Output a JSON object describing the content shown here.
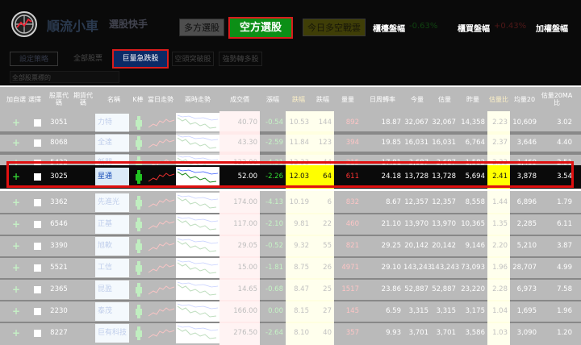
{
  "header": {
    "brand_name": "順流小車",
    "brand_sub": "選股快手",
    "tab_long": "多方選股",
    "tab_short": "空方選股",
    "tab_today": "今日多空戰雲",
    "otc_label": "櫃檯盤幅",
    "otc_value": "-0.63%",
    "tse_label": "櫃買盤幅",
    "tse_value": "+0.43%",
    "fav_label": "加權盤幅"
  },
  "subbar": {
    "settings": "設定策略",
    "all_stocks": "全部股票",
    "volume_drop": "巨量急跌股",
    "short_break": "空頭突破股",
    "strong_long": "強勢轉多股",
    "filter_placeholder": "全部股票標的"
  },
  "columns": [
    "加自選",
    "選擇",
    "股票代碼",
    "期貨代碼",
    "名稱",
    "K棒",
    "當日走勢",
    "兩時走勢",
    "成交價",
    "漲幅",
    "跌幅",
    "跌幅",
    "量量",
    "日周轉率",
    "今量",
    "估量",
    "昨量",
    "估量比",
    "均量20",
    "估量20MA比"
  ],
  "rows": [
    {
      "code": "3051",
      "name": "力特",
      "price": "40.70",
      "chg": "-0.54",
      "pct": "10.53",
      "n1": "144",
      "vol": "892",
      "turn": "18.87",
      "today": "32,067",
      "est": "32,067",
      "yest": "14,358",
      "ratio": "2.23",
      "avg": "10,609",
      "ma": "3.02"
    },
    {
      "code": "8068",
      "name": "全達",
      "price": "43.30",
      "chg": "-2.59",
      "pct": "11.84",
      "n1": "123",
      "vol": "394",
      "turn": "19.85",
      "today": "16,031",
      "est": "16,031",
      "yest": "6,764",
      "ratio": "2.37",
      "avg": "3,646",
      "ma": "4.40"
    },
    {
      "code": "5432",
      "name": "新門",
      "price": "122.00",
      "chg": "-4.31",
      "pct": "12.33",
      "n1": "44",
      "vol": "215",
      "turn": "17.81",
      "today": "3,687",
      "est": "3,687",
      "yest": "1,582",
      "ratio": "2.33",
      "avg": "1,469",
      "ma": "2.51"
    },
    {
      "code": "3025",
      "name": "星通",
      "price": "52.00",
      "chg": "-2.26",
      "pct": "12.03",
      "n1": "64",
      "vol": "611",
      "turn": "24.18",
      "today": "13,728",
      "est": "13,728",
      "yest": "5,694",
      "ratio": "2.41",
      "avg": "3,878",
      "ma": "3.54"
    },
    {
      "code": "3362",
      "name": "先進光",
      "price": "174.00",
      "chg": "-4.13",
      "pct": "10.19",
      "n1": "6",
      "vol": "832",
      "turn": "8.67",
      "today": "12,357",
      "est": "12,357",
      "yest": "8,558",
      "ratio": "1.44",
      "avg": "6,896",
      "ma": "1.79"
    },
    {
      "code": "6546",
      "name": "正基",
      "price": "117.00",
      "chg": "-2.10",
      "pct": "9.81",
      "n1": "22",
      "vol": "460",
      "turn": "21.10",
      "today": "13,970",
      "est": "13,970",
      "yest": "10,365",
      "ratio": "1.35",
      "avg": "2,285",
      "ma": "6.11"
    },
    {
      "code": "3390",
      "name": "旭軟",
      "price": "29.05",
      "chg": "-0.52",
      "pct": "9.32",
      "n1": "55",
      "vol": "821",
      "turn": "29.25",
      "today": "20,142",
      "est": "20,142",
      "yest": "9,146",
      "ratio": "2.20",
      "avg": "5,210",
      "ma": "3.87"
    },
    {
      "code": "5521",
      "name": "工信",
      "price": "15.00",
      "chg": "-1.81",
      "pct": "8.75",
      "n1": "26",
      "vol": "4971",
      "turn": "29.10",
      "today": "143,243",
      "est": "143,243",
      "yest": "73,093",
      "ratio": "1.96",
      "avg": "28,707",
      "ma": "4.99"
    },
    {
      "code": "2365",
      "name": "昆盈",
      "price": "14.65",
      "chg": "-0.68",
      "pct": "8.47",
      "n1": "25",
      "vol": "1517",
      "turn": "23.86",
      "today": "52,887",
      "est": "52,887",
      "yest": "23,220",
      "ratio": "2.28",
      "avg": "6,973",
      "ma": "7.58"
    },
    {
      "code": "2230",
      "name": "泰茂",
      "price": "166.00",
      "chg": "0.00",
      "pct": "8.15",
      "n1": "27",
      "vol": "145",
      "turn": "6.59",
      "today": "3,315",
      "est": "3,315",
      "yest": "3,175",
      "ratio": "1.04",
      "avg": "1,695",
      "ma": "1.96"
    },
    {
      "code": "8227",
      "name": "巨有科技",
      "price": "276.50",
      "chg": "-2.64",
      "pct": "8.10",
      "n1": "40",
      "vol": "357",
      "turn": "9.93",
      "today": "3,701",
      "est": "3,701",
      "yest": "3,586",
      "ratio": "1.03",
      "avg": "3,090",
      "ma": "1.20"
    }
  ],
  "icons": {
    "logo": "globe-logo-icon",
    "add": "plus-icon",
    "sort": "sort-arrow-icon"
  },
  "colors": {
    "header_bg": "#0a0a0a",
    "accent_green": "#0c8f16",
    "highlight": "#e01010",
    "yellow": "#ffff00"
  }
}
